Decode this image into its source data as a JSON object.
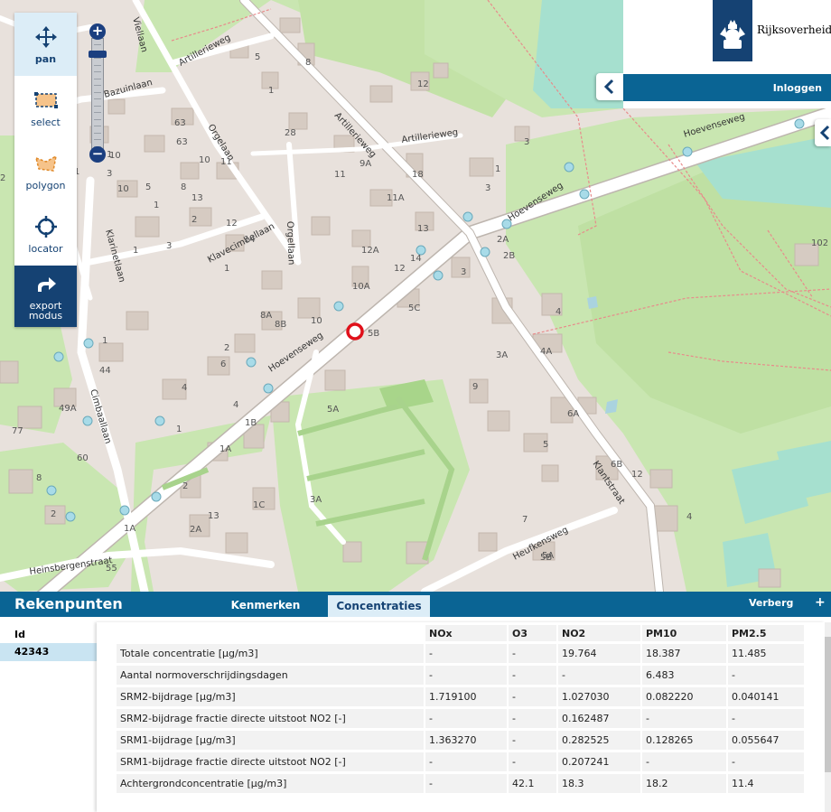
{
  "toolbar": {
    "tools": [
      {
        "label": "pan",
        "icon": "pan-icon",
        "active": true
      },
      {
        "label": "select",
        "icon": "select-icon",
        "active": false
      },
      {
        "label": "polygon",
        "icon": "polygon-icon",
        "active": false
      },
      {
        "label": "locator",
        "icon": "locator-icon",
        "active": false
      }
    ],
    "export_label_line1": "export",
    "export_label_line2": "modus"
  },
  "zoom": {
    "plus": "+",
    "minus": "−"
  },
  "header": {
    "org_name": "Rijksoverheid",
    "login_label": "Inloggen"
  },
  "map": {
    "streets": [
      "Hoevenseweg",
      "Hoevenseweg",
      "Hoevenseweg",
      "Artillerieweg",
      "Artillerieweg",
      "Artillerieweg",
      "Orgelaan",
      "Orgellaan",
      "Bazuinlaan",
      "Klavecimbellaan",
      "Klarinetlaan",
      "Cimbaallaan",
      "Klantstraat",
      "Heufkensweg",
      "Heinsbergenstraat",
      "Viellaan"
    ],
    "house_numbers": [
      "5",
      "8",
      "1",
      "12",
      "28",
      "11",
      "9A",
      "18",
      "3",
      "1",
      "11A",
      "3",
      "2A",
      "2B",
      "13",
      "12A",
      "14",
      "12",
      "10A",
      "5C",
      "8A",
      "8B",
      "10",
      "5B",
      "3",
      "4",
      "4A",
      "2",
      "3A",
      "5",
      "1",
      "44",
      "6",
      "4",
      "5A",
      "6A",
      "1B",
      "9",
      "49A",
      "4",
      "77",
      "1A",
      "1",
      "60",
      "2",
      "1C",
      "7",
      "6B",
      "12",
      "5B",
      "2",
      "1",
      "3A",
      "4",
      "2A",
      "13",
      "1A",
      "2",
      "5A",
      "55",
      "8",
      "63",
      "63",
      "13",
      "2",
      "1",
      "102",
      "1",
      "10",
      "3",
      "10",
      "1",
      "1",
      "3",
      "12",
      "14",
      "11",
      "5",
      "8",
      "10"
    ],
    "marker_color": "#e0101a",
    "point_color": "#a8dbe8"
  },
  "panel": {
    "title": "Rekenpunten",
    "tabs": [
      {
        "label": "Kenmerken",
        "active": false
      },
      {
        "label": "Concentraties",
        "active": true
      }
    ],
    "hide_label": "Verberg",
    "plus_label": "+",
    "id_header": "Id",
    "selected_id": "42343",
    "columns": [
      "",
      "NOx",
      "O3",
      "NO2",
      "PM10",
      "PM2.5"
    ],
    "rows": [
      [
        "Totale concentratie [µg/m3]",
        "-",
        "-",
        "19.764",
        "18.387",
        "11.485"
      ],
      [
        "Aantal normoverschrijdingsdagen",
        "-",
        "-",
        "-",
        "6.483",
        "-"
      ],
      [
        "SRM2-bijdrage [µg/m3]",
        "1.719100",
        "-",
        "1.027030",
        "0.082220",
        "0.040141"
      ],
      [
        "SRM2-bijdrage fractie directe uitstoot NO2 [-]",
        "-",
        "-",
        "0.162487",
        "-",
        "-"
      ],
      [
        "SRM1-bijdrage [µg/m3]",
        "1.363270",
        "-",
        "0.282525",
        "0.128265",
        "0.055647"
      ],
      [
        "SRM1-bijdrage fractie directe uitstoot NO2 [-]",
        "-",
        "-",
        "0.207241",
        "-",
        "-"
      ],
      [
        "Achtergrondconcentratie [µg/m3]",
        "-",
        "42.1",
        "18.3",
        "18.2",
        "11.4"
      ]
    ]
  },
  "colors": {
    "primary_blue": "#0a6494",
    "dark_blue": "#154273",
    "light_blue": "#dcedf7",
    "map_bg": "#e8e1dc",
    "park_green": "#c9e6b1",
    "sport_green": "#a6e0cf"
  }
}
